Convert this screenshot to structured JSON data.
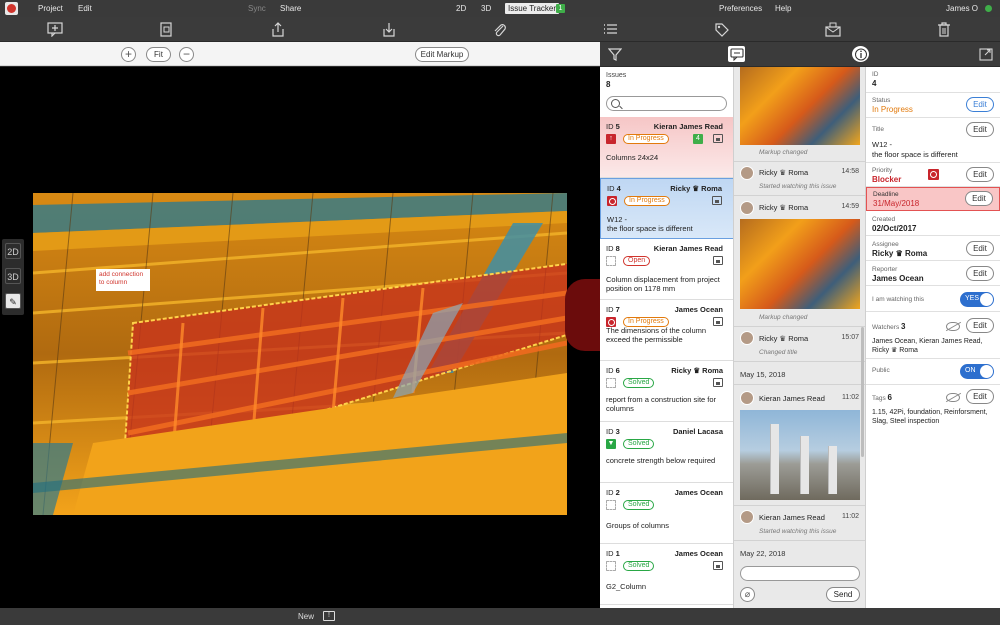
{
  "menubar": {
    "project": "Project",
    "edit": "Edit",
    "sync": "Sync",
    "share": "Share",
    "mode_2d": "2D",
    "mode_3d": "3D",
    "issue_tracker": "Issue Tracker",
    "issue_tracker_count": "1",
    "preferences": "Preferences",
    "help": "Help",
    "user": "James O"
  },
  "viewer": {
    "fit": "Fit",
    "edit_markup": "Edit Markup",
    "zoom_in": "+",
    "zoom_out": "−",
    "markup_note": "add connection to column"
  },
  "side_tools": {
    "t2d": "2D",
    "t3d": "3D"
  },
  "bottombar": {
    "new": "New"
  },
  "issues": {
    "label": "Issues",
    "count": "8",
    "list": [
      {
        "id_label": "ID",
        "id": "5",
        "assignee": "Kieran James Read",
        "status": "In Progress",
        "badge": "4",
        "title": "Columns 24x24"
      },
      {
        "id_label": "ID",
        "id": "4",
        "assignee": "Ricky ♛ Roma",
        "status": "In Progress",
        "title": "W12 -\nthe floor space is different"
      },
      {
        "id_label": "ID",
        "id": "8",
        "assignee": "Kieran James Read",
        "status": "Open",
        "title": "Column displacement from project position on 1178 mm"
      },
      {
        "id_label": "ID",
        "id": "7",
        "assignee": "James Ocean",
        "status": "In Progress",
        "title": "The dimensions of the column exceed the permissible"
      },
      {
        "id_label": "ID",
        "id": "6",
        "assignee": "Ricky ♛ Roma",
        "status": "Solved",
        "title": "report from a construction site for columns"
      },
      {
        "id_label": "ID",
        "id": "3",
        "assignee": "Daniel Lacasa",
        "status": "Solved",
        "title": "concrete strength below required"
      },
      {
        "id_label": "ID",
        "id": "2",
        "assignee": "James Ocean",
        "status": "Solved",
        "title": "Groups of columns"
      },
      {
        "id_label": "ID",
        "id": "1",
        "assignee": "James Ocean",
        "status": "Solved",
        "title": "G2_Column"
      }
    ]
  },
  "comments": {
    "markup_changed_1": "Markup changed",
    "c1_name": "Ricky ♛ Roma",
    "c1_time": "14:58",
    "c1_action": "Started watching this issue",
    "c2_name": "Ricky ♛ Roma",
    "c2_time": "14:59",
    "markup_changed_2": "Markup changed",
    "c3_name": "Ricky ♛ Roma",
    "c3_time": "15:07",
    "c3_action": "Changed title",
    "date1": "May 15, 2018",
    "c4_name": "Kieran James Read",
    "c4_time": "11:02",
    "c5_name": "Kieran James Read",
    "c5_time": "11:02",
    "c5_action": "Started watching this issue",
    "date2": "May 22, 2018",
    "send": "Send"
  },
  "details": {
    "id_label": "ID",
    "id": "4",
    "status_label": "Status",
    "status": "In Progress",
    "title_label": "Title",
    "title": "W12 -\nthe floor space is different",
    "priority_label": "Priority",
    "priority": "Blocker",
    "deadline_label": "Deadline",
    "deadline": "31/May/2018",
    "created_label": "Created",
    "created": "02/Oct/2017",
    "assignee_label": "Assignee",
    "assignee": "Ricky ♛ Roma",
    "reporter_label": "Reporter",
    "reporter": "James Ocean",
    "watching_label": "I am watching this",
    "watching_toggle": "YES",
    "watchers_label": "Watchers",
    "watchers_count": "3",
    "watchers": "James Ocean, Kieran James Read, Ricky ♛ Roma",
    "public_label": "Public",
    "public_toggle": "ON",
    "tags_label": "Tags",
    "tags_count": "6",
    "tags": "1.15, 42Pi, foundation, Reinforsment, Slag, Steel inspection",
    "edit": "Edit"
  },
  "colors": {
    "accent_blue": "#2d6fce",
    "status_progress": "#e27a0c",
    "status_open": "#d0342c",
    "status_solved": "#29a745",
    "deadline_bg": "#f9c6c6"
  }
}
